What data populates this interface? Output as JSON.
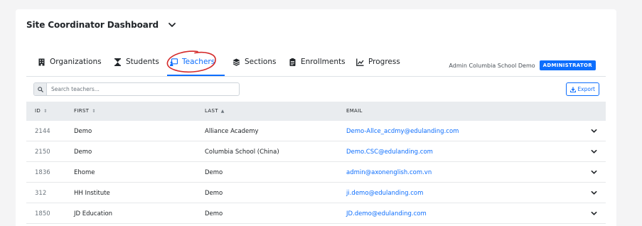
{
  "dashboard": {
    "title": "Site Coordinator Dashboard"
  },
  "tabs": [
    {
      "label": "Organizations",
      "icon": "building-icon"
    },
    {
      "label": "Students",
      "icon": "hourglass-icon"
    },
    {
      "label": "Teachers",
      "icon": "teacher-board-icon",
      "active": true
    },
    {
      "label": "Sections",
      "icon": "layers-icon"
    },
    {
      "label": "Enrollments",
      "icon": "clipboard-icon"
    },
    {
      "label": "Progress",
      "icon": "chart-line-icon"
    }
  ],
  "user": {
    "name": "Admin Columbia School Demo",
    "role": "ADMINISTRATOR"
  },
  "search": {
    "placeholder": "Search teachers..."
  },
  "export": {
    "label": "Export"
  },
  "table": {
    "columns": [
      {
        "label": "ID",
        "sort": "⇕"
      },
      {
        "label": "FIRST",
        "sort": "⇕"
      },
      {
        "label": "LAST",
        "sort": "▲"
      },
      {
        "label": "EMAIL",
        "sort": ""
      }
    ],
    "rows": [
      {
        "id": "2144",
        "first": "Demo",
        "last": "Alliance Academy",
        "email": "Demo-Allce_acdmy@edulanding.com"
      },
      {
        "id": "2150",
        "first": "Demo",
        "last": "Columbia School (China)",
        "email": "Demo.CSC@edulanding.com"
      },
      {
        "id": "1836",
        "first": "Ehome",
        "last": "Demo",
        "email": "admin@axonenglish.com.vn"
      },
      {
        "id": "312",
        "first": "HH Institute",
        "last": "Demo",
        "email": "ji.demo@edulanding.com"
      },
      {
        "id": "1850",
        "first": "JD Education",
        "last": "Demo",
        "email": "JD.demo@edulanding.com"
      }
    ]
  },
  "colors": {
    "accent": "#0d6efd",
    "annotation": "#d42a2a",
    "header_bg": "#e9ecef"
  }
}
